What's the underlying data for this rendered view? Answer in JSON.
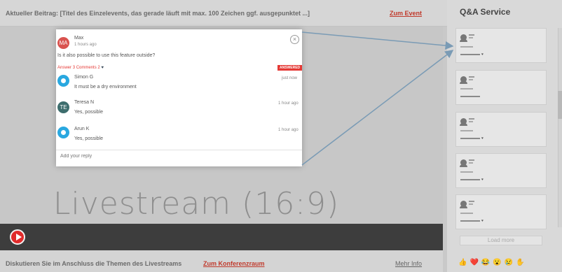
{
  "header": {
    "current_post": "Aktueller Beitrag: [Titel des Einzelevents, das gerade läuft mit max. 100 Zeichen ggf. ausgepunktet ...]",
    "event_link": "Zum Event"
  },
  "stream": {
    "label": "Livestream (16:9)"
  },
  "footer": {
    "discuss": "Diskutieren Sie im Anschluss die Themen des Livestreams",
    "conference_link": "Zum Konferenzraum",
    "more_info": "Mehr Info"
  },
  "popup": {
    "question": {
      "initials": "MA",
      "author": "Max",
      "time": "1 hours ago",
      "text": "Is it also possible to use this feature outside?"
    },
    "answer_label": "Answer",
    "comments_label": "3 Comments",
    "likes": "2",
    "status": "ANSWERED",
    "replies": [
      {
        "author": "Simon G",
        "initials": "",
        "time": "just now",
        "text": "It must be a dry environment"
      },
      {
        "author": "Teresa N",
        "initials": "TE",
        "time": "1 hour ago",
        "text": "Yes, possible"
      },
      {
        "author": "Arun K",
        "initials": "",
        "time": "1 hour ago",
        "text": "Yes, possible"
      }
    ],
    "reply_placeholder": "Add your reply"
  },
  "sidebar": {
    "title": "Q&A Service",
    "load_more": "Load more",
    "reactions": "👍❤️😂😮😢✋"
  },
  "colors": {
    "accent_red": "#e53935",
    "link_red": "#c0392b",
    "player_bg": "#3d3d3d",
    "arrow": "#7a9bb5"
  }
}
